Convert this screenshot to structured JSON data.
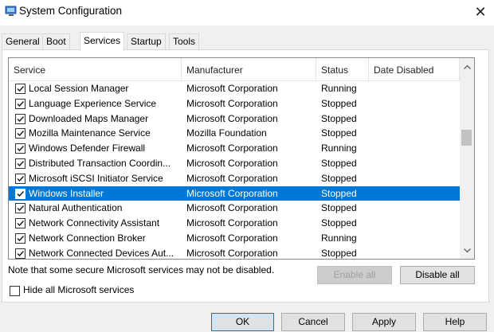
{
  "window": {
    "title": "System Configuration",
    "close_glyph": "✕"
  },
  "tabs": [
    {
      "label": "General",
      "active": false
    },
    {
      "label": "Boot",
      "active": false
    },
    {
      "label": "Services",
      "active": true
    },
    {
      "label": "Startup",
      "active": false
    },
    {
      "label": "Tools",
      "active": false
    }
  ],
  "table": {
    "headers": [
      "Service",
      "Manufacturer",
      "Status",
      "Date Disabled"
    ],
    "rows": [
      {
        "checked": true,
        "service": "Local Session Manager",
        "manufacturer": "Microsoft Corporation",
        "status": "Running",
        "date_disabled": "",
        "selected": false
      },
      {
        "checked": true,
        "service": "Language Experience Service",
        "manufacturer": "Microsoft Corporation",
        "status": "Stopped",
        "date_disabled": "",
        "selected": false
      },
      {
        "checked": true,
        "service": "Downloaded Maps Manager",
        "manufacturer": "Microsoft Corporation",
        "status": "Stopped",
        "date_disabled": "",
        "selected": false
      },
      {
        "checked": true,
        "service": "Mozilla Maintenance Service",
        "manufacturer": "Mozilla Foundation",
        "status": "Stopped",
        "date_disabled": "",
        "selected": false
      },
      {
        "checked": true,
        "service": "Windows Defender Firewall",
        "manufacturer": "Microsoft Corporation",
        "status": "Running",
        "date_disabled": "",
        "selected": false
      },
      {
        "checked": true,
        "service": "Distributed Transaction Coordin...",
        "manufacturer": "Microsoft Corporation",
        "status": "Stopped",
        "date_disabled": "",
        "selected": false
      },
      {
        "checked": true,
        "service": "Microsoft iSCSI Initiator Service",
        "manufacturer": "Microsoft Corporation",
        "status": "Stopped",
        "date_disabled": "",
        "selected": false
      },
      {
        "checked": true,
        "service": "Windows Installer",
        "manufacturer": "Microsoft Corporation",
        "status": "Stopped",
        "date_disabled": "",
        "selected": true
      },
      {
        "checked": true,
        "service": "Natural Authentication",
        "manufacturer": "Microsoft Corporation",
        "status": "Stopped",
        "date_disabled": "",
        "selected": false
      },
      {
        "checked": true,
        "service": "Network Connectivity Assistant",
        "manufacturer": "Microsoft Corporation",
        "status": "Stopped",
        "date_disabled": "",
        "selected": false
      },
      {
        "checked": true,
        "service": "Network Connection Broker",
        "manufacturer": "Microsoft Corporation",
        "status": "Running",
        "date_disabled": "",
        "selected": false
      },
      {
        "checked": true,
        "service": "Network Connected Devices Aut...",
        "manufacturer": "Microsoft Corporation",
        "status": "Stopped",
        "date_disabled": "",
        "selected": false
      }
    ]
  },
  "note": "Note that some secure Microsoft services may not be disabled.",
  "buttons": {
    "enable_all": "Enable all",
    "disable_all": "Disable all",
    "ok": "OK",
    "cancel": "Cancel",
    "apply": "Apply",
    "help": "Help"
  },
  "hide_ms": {
    "label": "Hide all Microsoft services",
    "checked": false
  },
  "colors": {
    "selection": "#0078d7",
    "window_bg": "#f0f0f0"
  },
  "icons": {
    "app": "system-config-icon",
    "close": "close-icon",
    "scroll_up": "chevron-up-icon",
    "scroll_down": "chevron-down-icon",
    "check": "checkmark-icon"
  }
}
